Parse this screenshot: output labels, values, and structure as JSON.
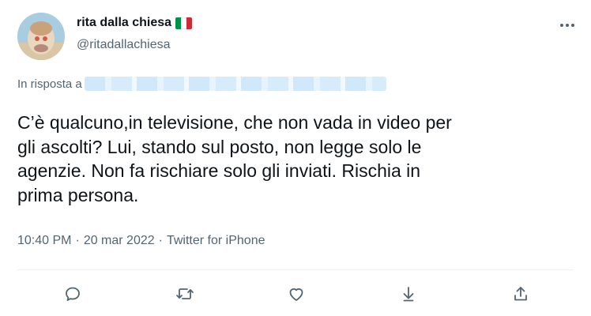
{
  "author": {
    "display_name": "rita dalla chiesa",
    "handle": "@ritadallachiesa",
    "flag_colors": [
      "#009246",
      "#ffffff",
      "#ce2b37"
    ],
    "avatar_icon": "avatar-photo"
  },
  "reply": {
    "label": "In risposta a"
  },
  "tweet": {
    "text": "C’è qualcuno,in televisione,  che non vada in video per\ngli ascolti? Lui, stando sul posto, non legge solo le\nagenzie. Non fa rischiare solo gli inviati. Rischia in\nprima persona.",
    "time": "10:40 PM",
    "separator": "·",
    "date": "20 mar 2022",
    "source": "Twitter for iPhone"
  },
  "actions": {
    "icons": [
      "reply-icon",
      "retweet-icon",
      "like-icon",
      "bookmark-icon",
      "share-icon"
    ],
    "icon_color": "#536471"
  }
}
